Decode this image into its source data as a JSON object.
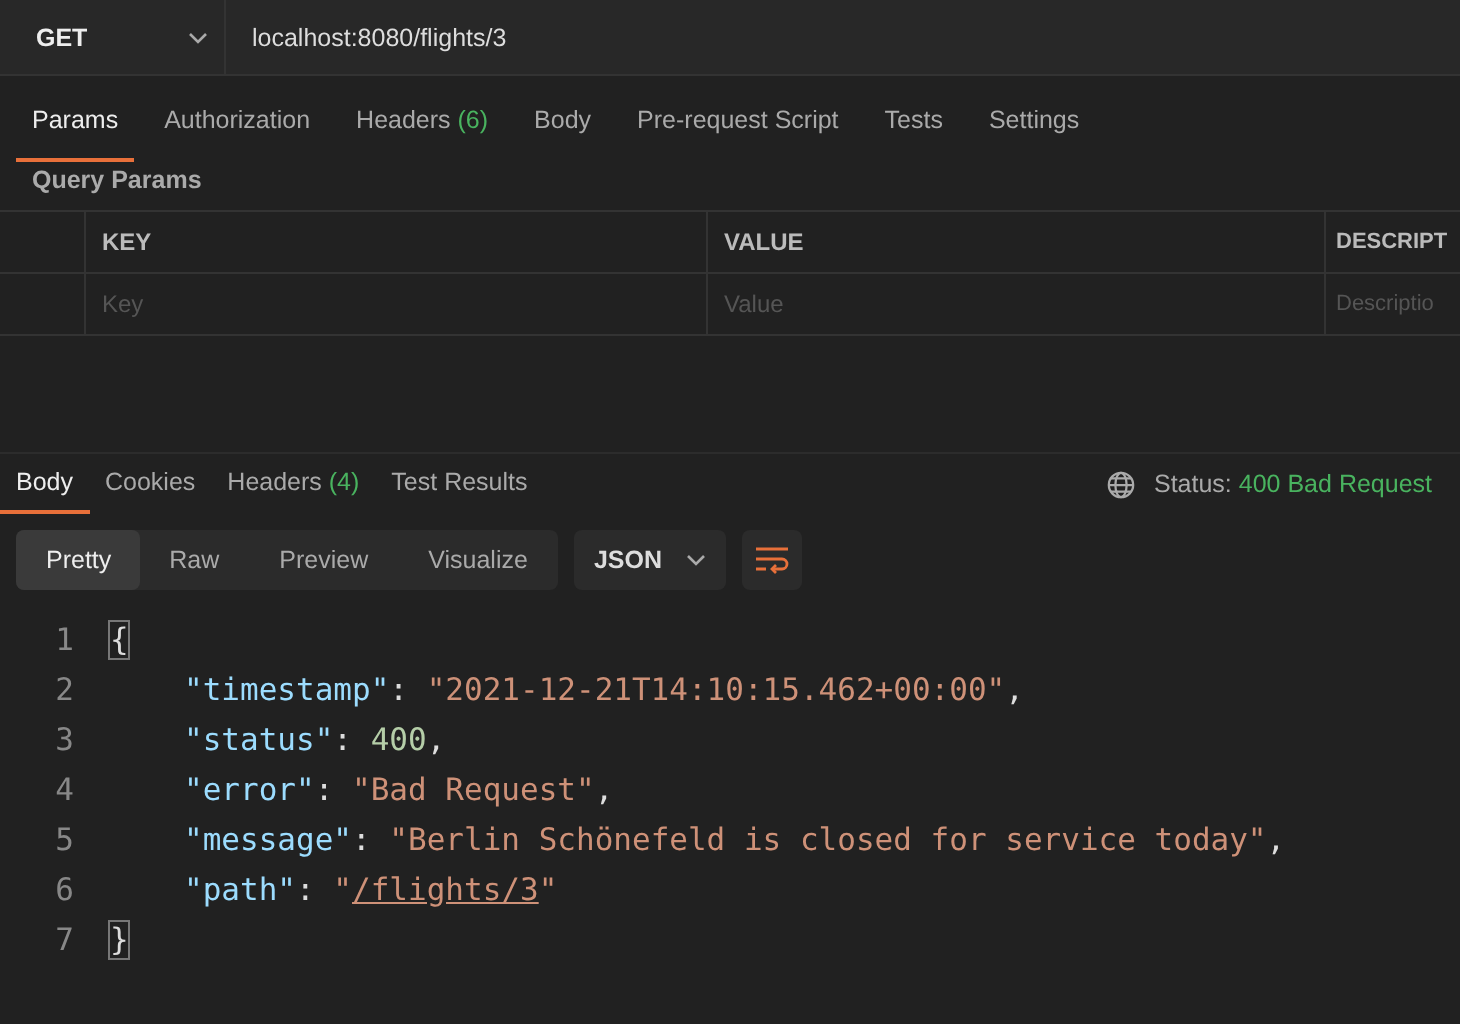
{
  "request": {
    "method": "GET",
    "url": "localhost:8080/flights/3"
  },
  "request_tabs": [
    {
      "label": "Params",
      "selected": true
    },
    {
      "label": "Authorization",
      "selected": false
    },
    {
      "label": "Headers",
      "count": "(6)",
      "selected": false
    },
    {
      "label": "Body",
      "selected": false
    },
    {
      "label": "Pre-request Script",
      "selected": false
    },
    {
      "label": "Tests",
      "selected": false
    },
    {
      "label": "Settings",
      "selected": false
    }
  ],
  "query_params": {
    "title": "Query Params",
    "columns": [
      "KEY",
      "VALUE",
      "DESCRIPT"
    ],
    "placeholders": [
      "Key",
      "Value",
      "Descriptio"
    ]
  },
  "response_tabs": [
    {
      "label": "Body",
      "selected": true
    },
    {
      "label": "Cookies",
      "selected": false
    },
    {
      "label": "Headers",
      "count": "(4)",
      "selected": false
    },
    {
      "label": "Test Results",
      "selected": false
    }
  ],
  "status": {
    "label": "Status:",
    "value": "400 Bad Request"
  },
  "view_modes": [
    {
      "label": "Pretty",
      "selected": true
    },
    {
      "label": "Raw",
      "selected": false
    },
    {
      "label": "Preview",
      "selected": false
    },
    {
      "label": "Visualize",
      "selected": false
    }
  ],
  "format": "JSON",
  "code_lines": [
    {
      "number": "1",
      "kind": "brace",
      "tokens": [
        {
          "kind": "punct",
          "text": "{"
        }
      ]
    },
    {
      "number": "2",
      "kind": "entry",
      "tokens": [
        {
          "kind": "key",
          "text": "\"timestamp\""
        },
        {
          "kind": "punct",
          "text": ": "
        },
        {
          "kind": "string",
          "text": "\"2021-12-21T14:10:15.462+00:00\""
        },
        {
          "kind": "punct",
          "text": ","
        }
      ]
    },
    {
      "number": "3",
      "kind": "entry",
      "tokens": [
        {
          "kind": "key",
          "text": "\"status\""
        },
        {
          "kind": "punct",
          "text": ": "
        },
        {
          "kind": "number",
          "text": "400"
        },
        {
          "kind": "punct",
          "text": ","
        }
      ]
    },
    {
      "number": "4",
      "kind": "entry",
      "tokens": [
        {
          "kind": "key",
          "text": "\"error\""
        },
        {
          "kind": "punct",
          "text": ": "
        },
        {
          "kind": "string",
          "text": "\"Bad Request\""
        },
        {
          "kind": "punct",
          "text": ","
        }
      ]
    },
    {
      "number": "5",
      "kind": "entry",
      "tokens": [
        {
          "kind": "key",
          "text": "\"message\""
        },
        {
          "kind": "punct",
          "text": ": "
        },
        {
          "kind": "string",
          "text": "\"Berlin Schönefeld is closed for service today\""
        },
        {
          "kind": "punct",
          "text": ","
        }
      ]
    },
    {
      "number": "6",
      "kind": "entry",
      "tokens": [
        {
          "kind": "key",
          "text": "\"path\""
        },
        {
          "kind": "punct",
          "text": ": "
        },
        {
          "kind": "string",
          "text": "\""
        },
        {
          "kind": "link",
          "text": "/flights/3"
        },
        {
          "kind": "string",
          "text": "\""
        }
      ]
    },
    {
      "number": "7",
      "kind": "brace",
      "tokens": [
        {
          "kind": "punct",
          "text": "}"
        }
      ]
    }
  ]
}
